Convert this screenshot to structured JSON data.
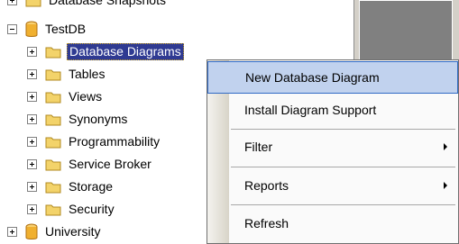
{
  "tree": {
    "cut_top_label": "Database Snapshots",
    "db_label": "TestDB",
    "children": [
      {
        "label": "Database Diagrams",
        "selected": true
      },
      {
        "label": "Tables"
      },
      {
        "label": "Views"
      },
      {
        "label": "Synonyms"
      },
      {
        "label": "Programmability"
      },
      {
        "label": "Service Broker"
      },
      {
        "label": "Storage"
      },
      {
        "label": "Security"
      }
    ],
    "next_db_label": "University"
  },
  "context_menu": {
    "items": [
      {
        "label": "New Database Diagram",
        "submenu": false,
        "highlighted": true
      },
      {
        "label": "Install Diagram Support",
        "submenu": false
      },
      {
        "label": "Filter",
        "submenu": true
      },
      {
        "label": "Reports",
        "submenu": true
      },
      {
        "label": "Refresh",
        "submenu": false
      }
    ]
  },
  "colors": {
    "selection": "#2f3a92",
    "menu_highlight": "#c1d2ee",
    "folder": "#f3d36a",
    "database": "#f0b030"
  }
}
